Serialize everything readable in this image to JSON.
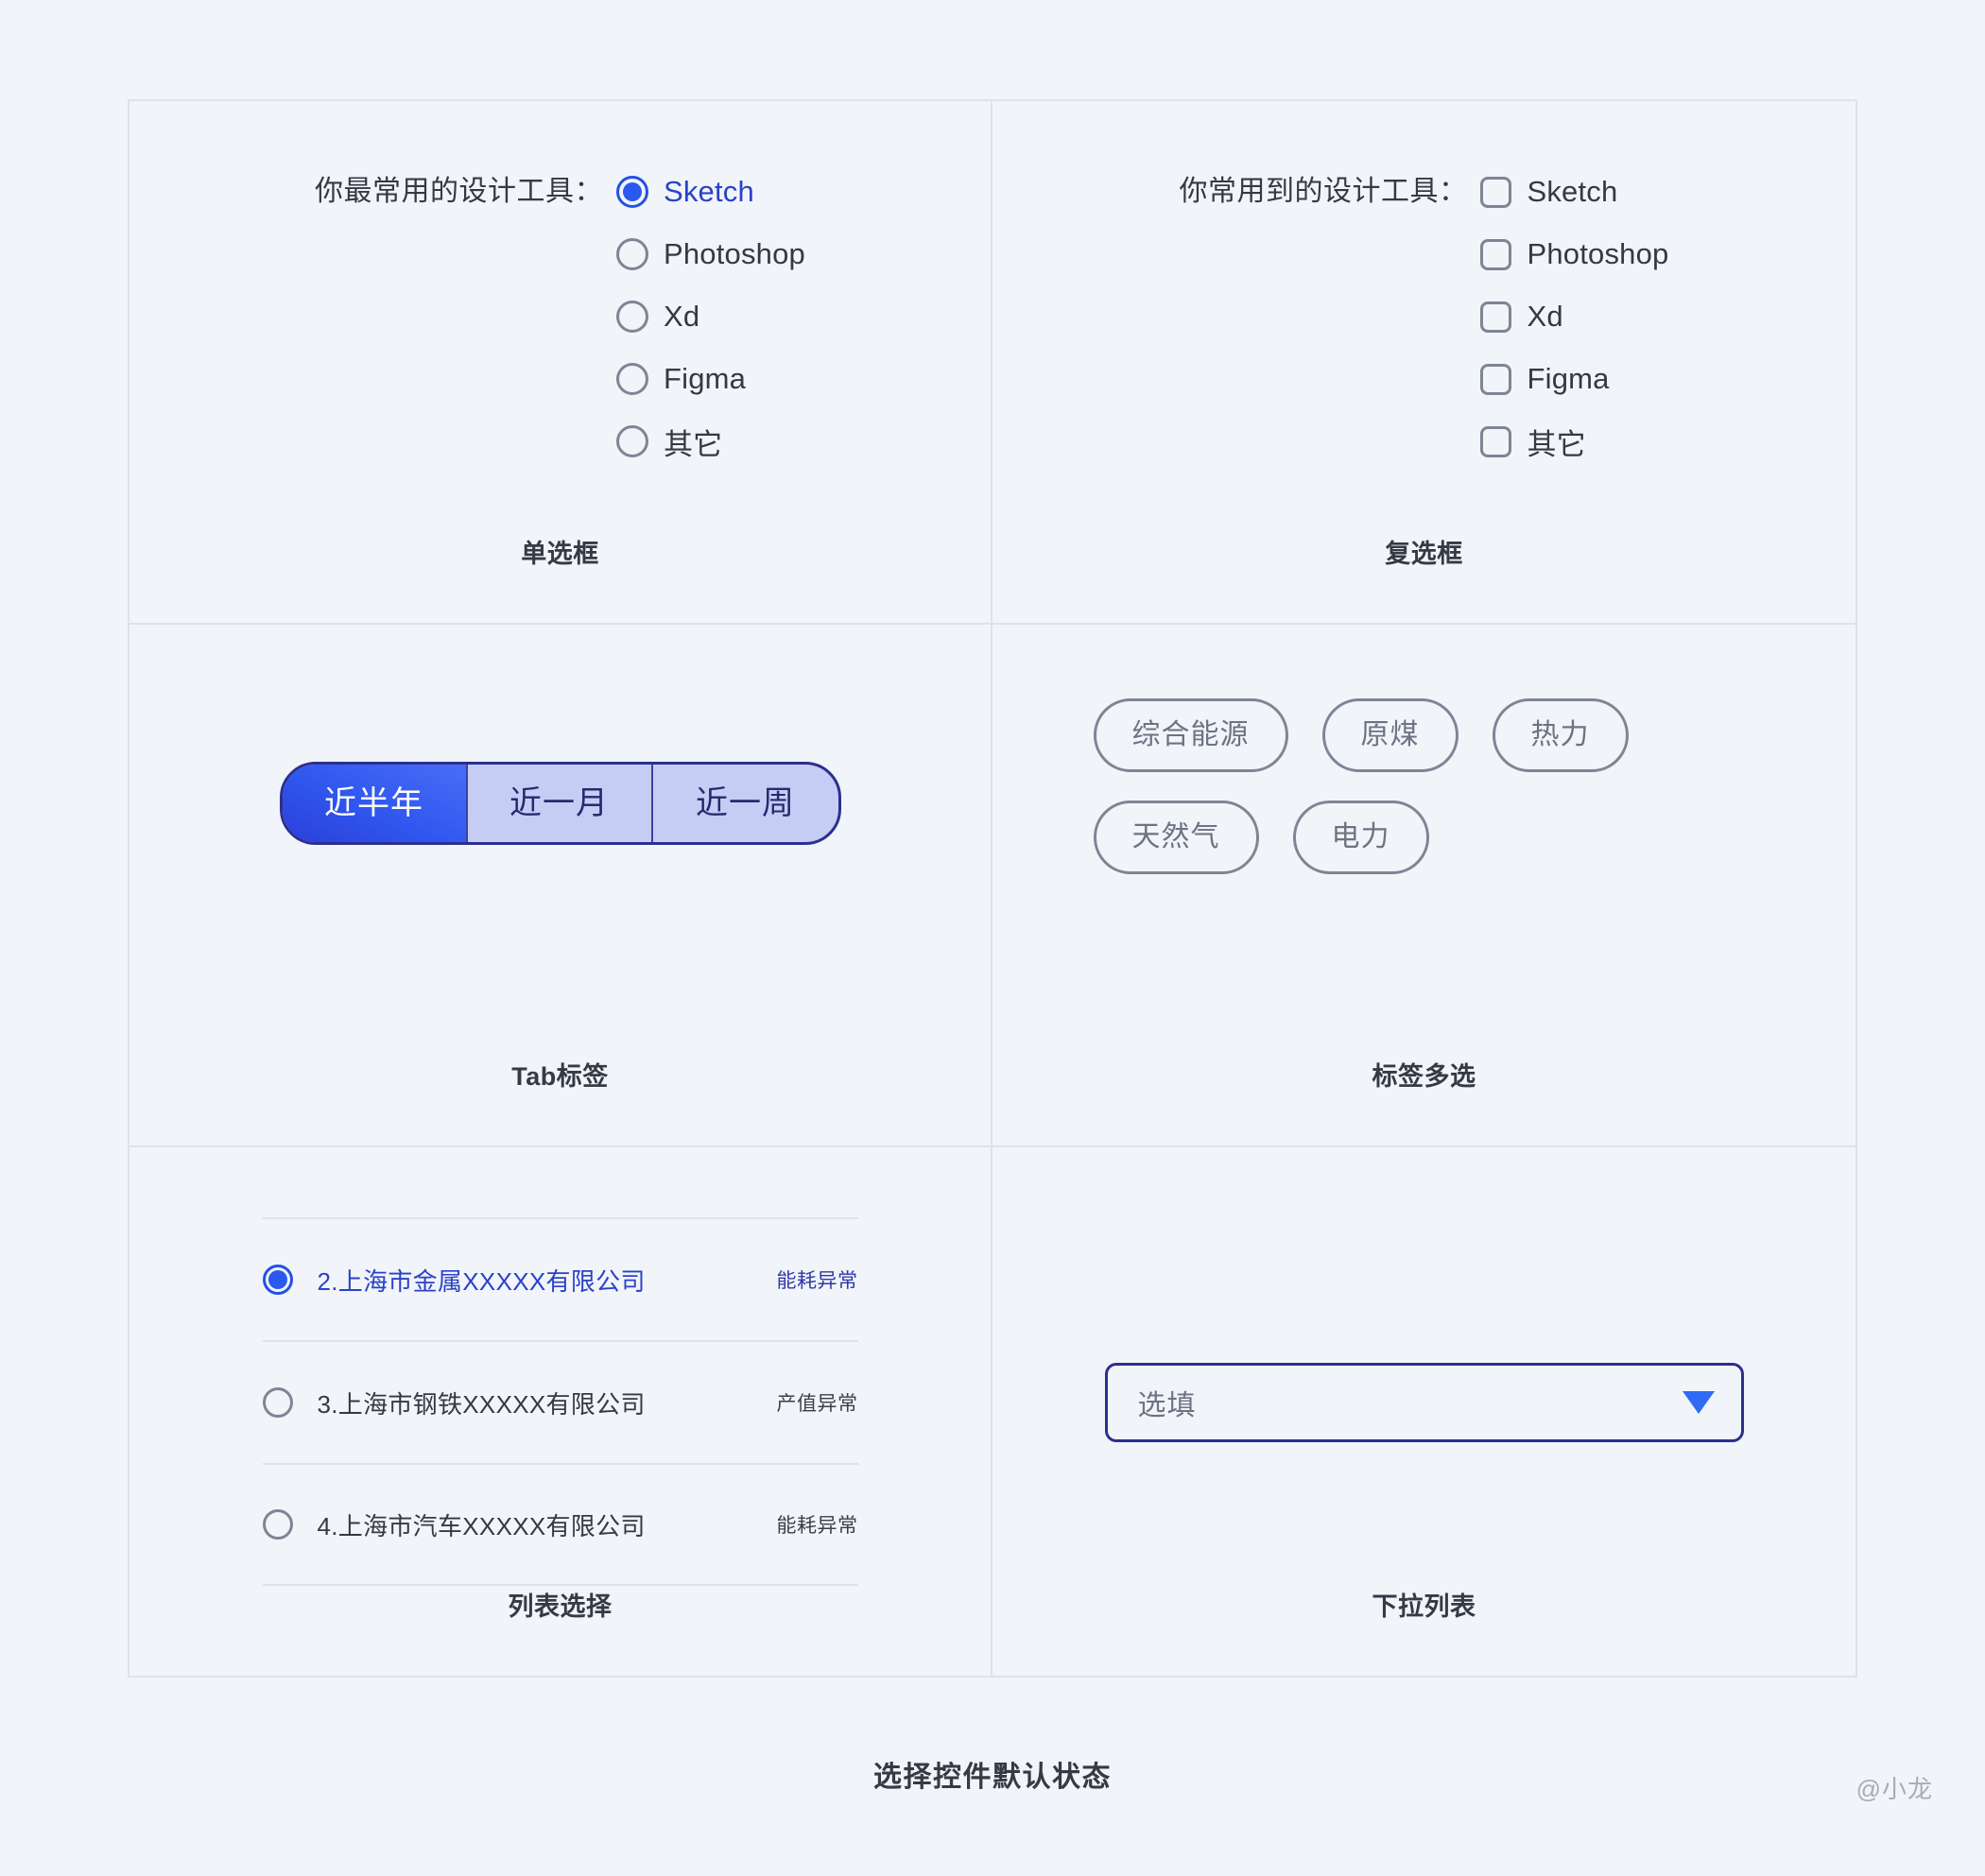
{
  "footer": {
    "title": "选择控件默认状态",
    "watermark": "@小龙"
  },
  "radio_panel": {
    "caption": "单选框",
    "prompt": "你最常用的设计工具：",
    "options": [
      {
        "label": "Sketch",
        "selected": true
      },
      {
        "label": "Photoshop",
        "selected": false
      },
      {
        "label": "Xd",
        "selected": false
      },
      {
        "label": "Figma",
        "selected": false
      },
      {
        "label": "其它",
        "selected": false
      }
    ]
  },
  "checkbox_panel": {
    "caption": "复选框",
    "prompt": "你常用到的设计工具：",
    "options": [
      {
        "label": "Sketch",
        "checked": false
      },
      {
        "label": "Photoshop",
        "checked": false
      },
      {
        "label": "Xd",
        "checked": false
      },
      {
        "label": "Figma",
        "checked": false
      },
      {
        "label": "其它",
        "checked": false
      }
    ]
  },
  "tab_panel": {
    "caption": "Tab标签",
    "segments": [
      {
        "label": "近半年",
        "active": true
      },
      {
        "label": "近一月",
        "active": false
      },
      {
        "label": "近一周",
        "active": false
      }
    ]
  },
  "tag_panel": {
    "caption": "标签多选",
    "tags": [
      {
        "label": "综合能源",
        "selected": false
      },
      {
        "label": "原煤",
        "selected": false
      },
      {
        "label": "热力",
        "selected": false
      },
      {
        "label": "天然气",
        "selected": false
      },
      {
        "label": "电力",
        "selected": false
      }
    ]
  },
  "list_panel": {
    "caption": "列表选择",
    "rows": [
      {
        "name": "2.上海市金属XXXXX有限公司",
        "status": "能耗异常",
        "selected": true
      },
      {
        "name": "3.上海市钢铁XXXXX有限公司",
        "status": "产值异常",
        "selected": false
      },
      {
        "name": "4.上海市汽车XXXXX有限公司",
        "status": "能耗异常",
        "selected": false
      }
    ]
  },
  "dropdown_panel": {
    "caption": "下拉列表",
    "value": "选填",
    "arrow_icon": "chevron-down-icon"
  },
  "colors": {
    "page_bg": "#f1f4f9",
    "accent_blue": "#2a59f0",
    "deep_navy": "#2c2f8f",
    "tab_inactive": "#c6cdf5",
    "muted_gray": "#7e8594",
    "divider": "#dfe2e8"
  }
}
